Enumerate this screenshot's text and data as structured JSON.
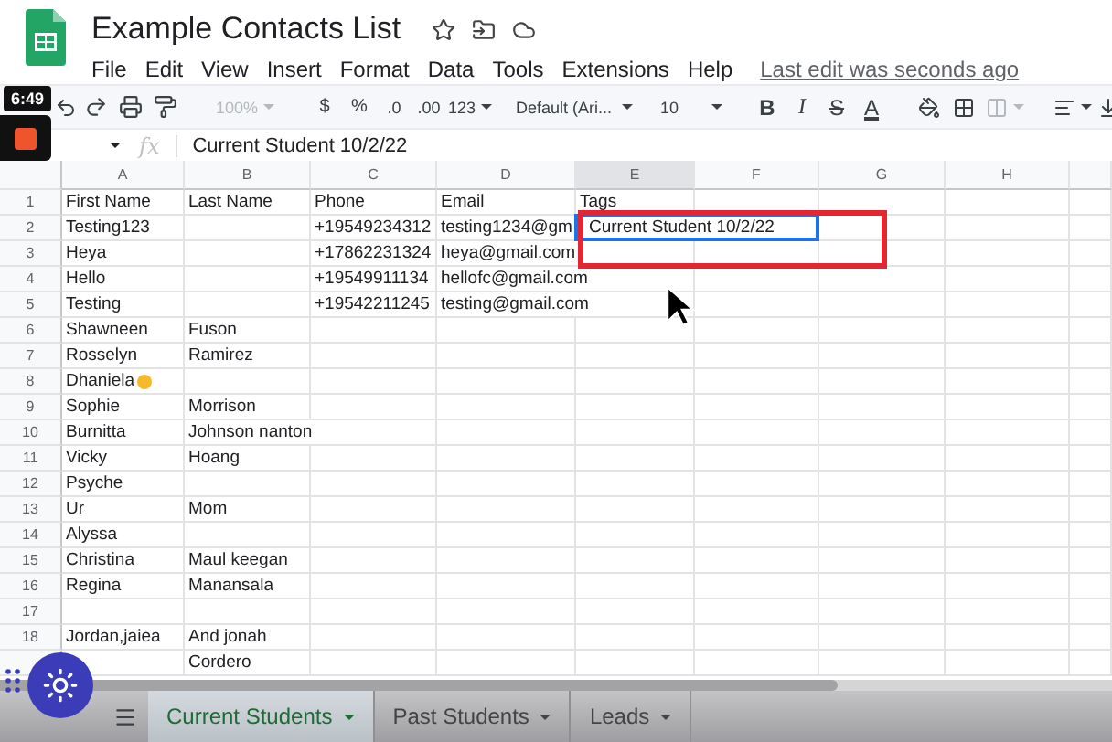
{
  "document": {
    "title": "Example Contacts List",
    "menus": [
      "File",
      "Edit",
      "View",
      "Insert",
      "Format",
      "Data",
      "Tools",
      "Extensions",
      "Help"
    ],
    "last_edit": "Last edit was seconds ago"
  },
  "recording": {
    "time": "6:49"
  },
  "toolbar": {
    "zoom": {
      "label": "100%",
      "disabled": true
    },
    "currency": "$",
    "percent": "%",
    "decrease_decimals": ".0",
    "increase_decimals": ".00",
    "more_formats": "123",
    "font": "Default (Ari...",
    "font_size": "10",
    "bold": "B",
    "italic": "I",
    "strikethrough": "S",
    "text_color": "A",
    "merge": {
      "disabled": true
    }
  },
  "formula_bar": {
    "fx": "fx",
    "value": "Current Student 10/2/22"
  },
  "sheet": {
    "columns": [
      {
        "label": "A",
        "selected": false
      },
      {
        "label": "B",
        "selected": false
      },
      {
        "label": "C",
        "selected": false
      },
      {
        "label": "D",
        "selected": false
      },
      {
        "label": "E",
        "selected": true
      },
      {
        "label": "F",
        "selected": false
      },
      {
        "label": "G",
        "selected": false
      },
      {
        "label": "H",
        "selected": false
      }
    ],
    "rows": [
      {
        "number": "1",
        "editing": false,
        "cells": {
          "a": "First Name",
          "b": "Last Name",
          "c": "Phone",
          "d": "Email",
          "e": "Tags"
        }
      },
      {
        "number": "2",
        "editing": true,
        "cells": {
          "a": "Testing123",
          "c": "+19549234312",
          "d": "testing1234@gm",
          "e": "Current Student 10/2/22"
        }
      },
      {
        "number": "3",
        "editing": false,
        "cells": {
          "a": "Heya",
          "c": "+17862231324",
          "d": "heya@gmail.com"
        }
      },
      {
        "number": "4",
        "editing": false,
        "cells": {
          "a": "Hello",
          "c": "+19549911134",
          "d": "hellofc@gmail.com"
        }
      },
      {
        "number": "5",
        "editing": false,
        "cells": {
          "a": "Testing",
          "c": "+19542211245",
          "d": "testing@gmail.com"
        }
      },
      {
        "number": "6",
        "editing": false,
        "cells": {
          "a": "Shawneen",
          "b": "Fuson"
        }
      },
      {
        "number": "7",
        "editing": false,
        "cells": {
          "a": "Rosselyn",
          "b": "Ramirez"
        }
      },
      {
        "number": "8",
        "editing": false,
        "emoji": true,
        "cells": {
          "a": "Dhaniela"
        }
      },
      {
        "number": "9",
        "editing": false,
        "cells": {
          "a": "Sophie",
          "b": "Morrison"
        }
      },
      {
        "number": "10",
        "editing": false,
        "cells": {
          "a": "Burnitta",
          "b": "Johnson nanton"
        }
      },
      {
        "number": "11",
        "editing": false,
        "cells": {
          "a": "Vicky",
          "b": "Hoang"
        }
      },
      {
        "number": "12",
        "editing": false,
        "cells": {
          "a": "Psyche"
        }
      },
      {
        "number": "13",
        "editing": false,
        "cells": {
          "a": "Ur",
          "b": "Mom"
        }
      },
      {
        "number": "14",
        "editing": false,
        "cells": {
          "a": "Alyssa"
        }
      },
      {
        "number": "15",
        "editing": false,
        "cells": {
          "a": "Christina",
          "b": "Maul keegan"
        }
      },
      {
        "number": "16",
        "editing": false,
        "cells": {
          "a": "Regina",
          "b": "Manansala"
        }
      },
      {
        "number": "17",
        "editing": false,
        "cells": {}
      },
      {
        "number": "18",
        "editing": false,
        "cells": {
          "a": "Jordan,jaiea",
          "b": "And jonah"
        }
      },
      {
        "editing": false,
        "cells": {
          "b": "Cordero"
        }
      }
    ]
  },
  "sheet_tabs": [
    {
      "label": "Current Students",
      "selected": true
    },
    {
      "label": "Past Students",
      "selected": false
    },
    {
      "label": "Leads",
      "selected": false
    }
  ]
}
